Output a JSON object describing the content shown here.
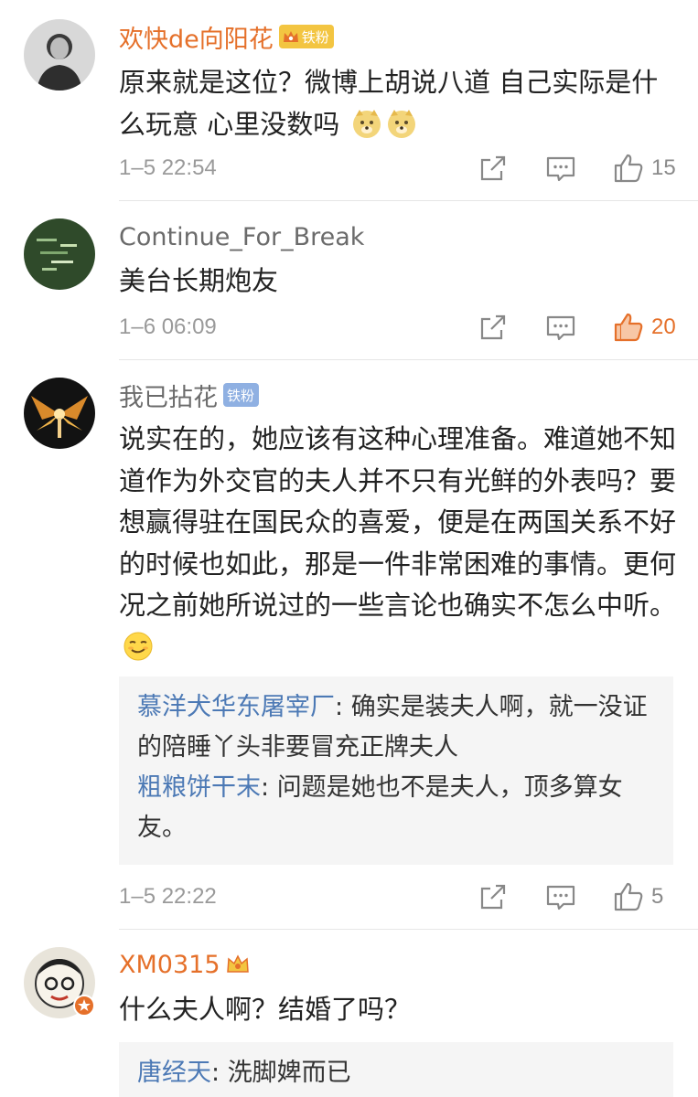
{
  "comments": [
    {
      "name": "欢快de向阳花",
      "badge": "铁粉",
      "text": "原来就是这位？微博上胡说八道 自己实际是什么玩意 心里没数吗",
      "time": "1–5 22:54",
      "likes": "15"
    },
    {
      "name": "Continue_For_Break",
      "text": "美台长期炮友",
      "time": "1–6 06:09",
      "likes": "20"
    },
    {
      "name": "我已拈花",
      "badge": "铁粉",
      "text": "说实在的，她应该有这种心理准备。难道她不知道作为外交官的夫人并不只有光鲜的外表吗？要想赢得驻在国民众的喜爱，便是在两国关系不好的时候也如此，那是一件非常困难的事情。更何况之前她所说过的一些言论也确实不怎么中听。",
      "time": "1–5 22:22",
      "likes": "5",
      "replies": [
        {
          "name": "慕洋犬华东屠宰厂",
          "text": "确实是装夫人啊，就一没证的陪睡丫头非要冒充正牌夫人"
        },
        {
          "name": "粗粮饼干末",
          "text": "问题是她也不是夫人，顶多算女友。"
        }
      ]
    },
    {
      "name": "XM0315",
      "text": "什么夫人啊？结婚了吗？",
      "replies": [
        {
          "name": "唐经天",
          "text": "洗脚婢而已"
        }
      ]
    }
  ],
  "colors": {
    "vip_name": "#e5702a",
    "reply_name": "#4c79b5",
    "liked": "#e5702a"
  }
}
